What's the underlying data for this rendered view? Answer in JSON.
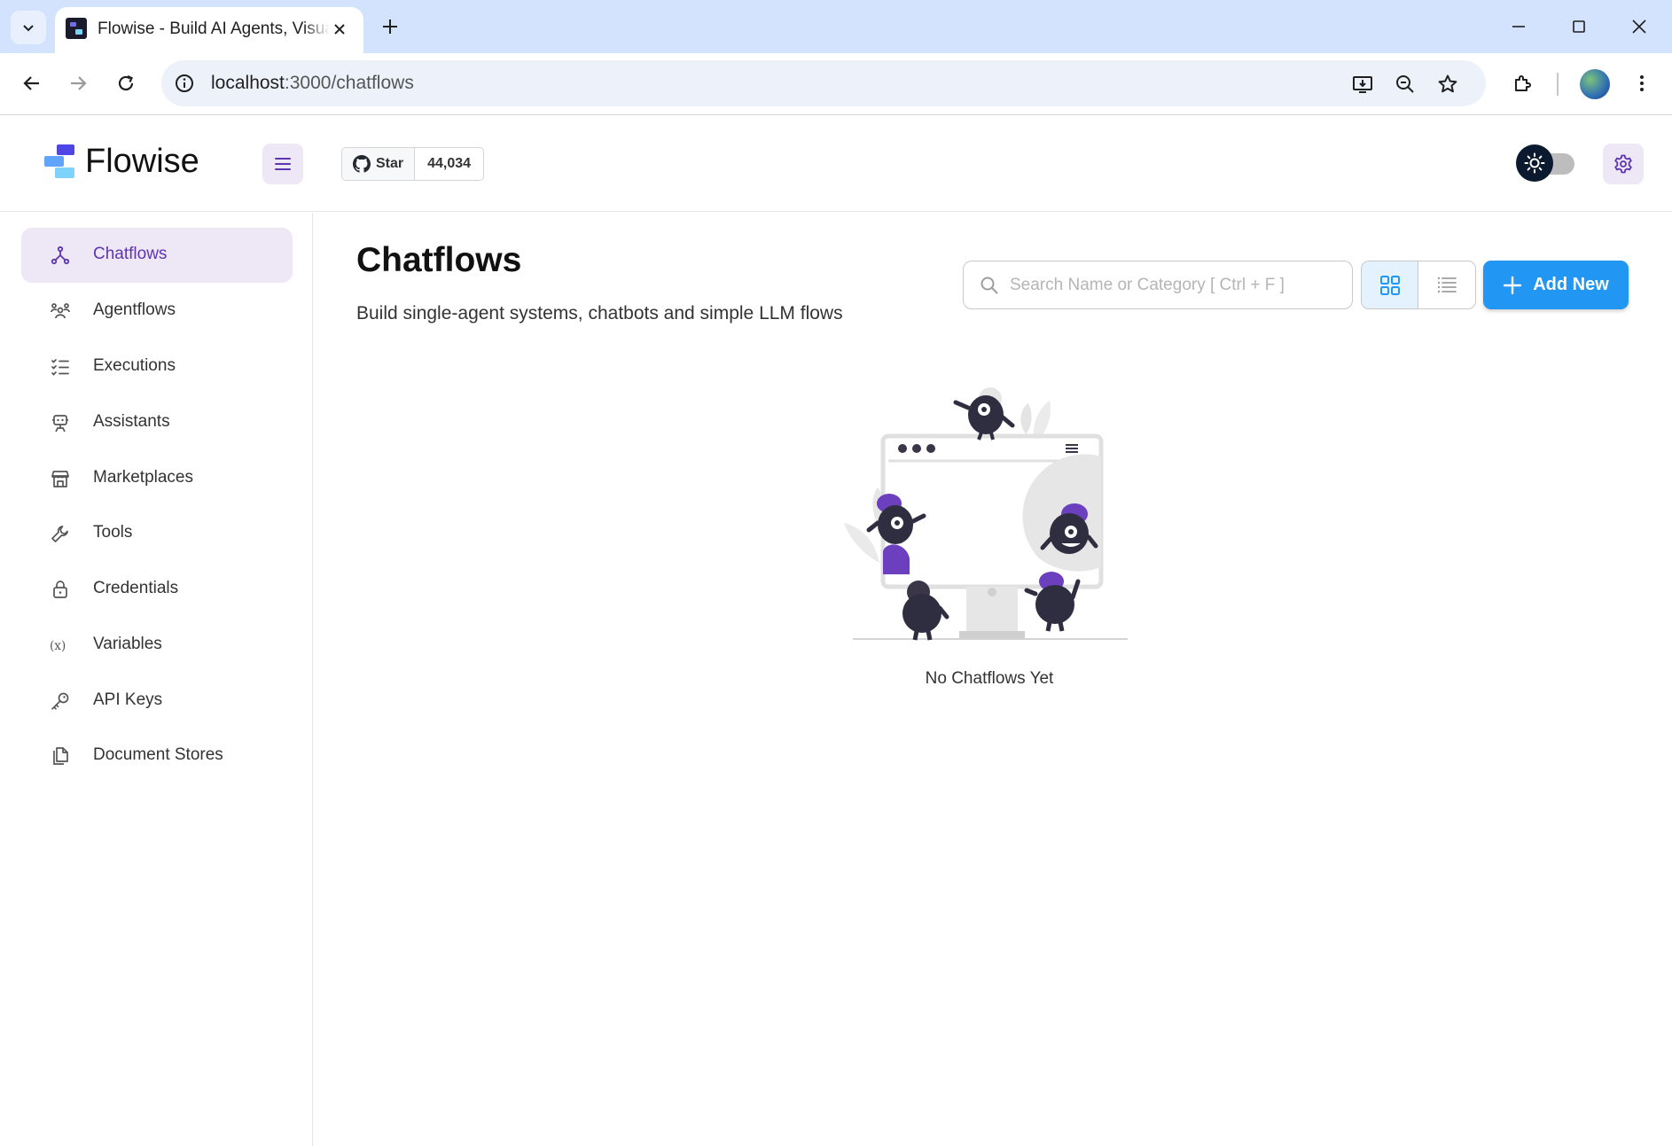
{
  "browser": {
    "tab_title": "Flowise - Build AI Agents, Visually",
    "url_host": "localhost",
    "url_path": ":3000/chatflows"
  },
  "header": {
    "brand": "Flowise",
    "github_star_label": "Star",
    "github_star_count": "44,034"
  },
  "sidebar": {
    "items": [
      {
        "label": "Chatflows",
        "icon": "hierarchy-icon",
        "active": true
      },
      {
        "label": "Agentflows",
        "icon": "users-group-icon"
      },
      {
        "label": "Executions",
        "icon": "list-check-icon"
      },
      {
        "label": "Assistants",
        "icon": "robot-icon"
      },
      {
        "label": "Marketplaces",
        "icon": "store-icon"
      },
      {
        "label": "Tools",
        "icon": "wrench-icon"
      },
      {
        "label": "Credentials",
        "icon": "lock-icon"
      },
      {
        "label": "Variables",
        "icon": "variable-icon"
      },
      {
        "label": "API Keys",
        "icon": "key-icon"
      },
      {
        "label": "Document Stores",
        "icon": "files-icon"
      }
    ]
  },
  "main": {
    "title": "Chatflows",
    "subtitle": "Build single-agent systems, chatbots and simple LLM flows",
    "search_placeholder": "Search Name or Category [ Ctrl + F ]",
    "add_button": "Add New",
    "empty_text": "No Chatflows Yet",
    "active_view": "grid"
  },
  "colors": {
    "accent_purple": "#5e35b1",
    "accent_blue": "#2196f3",
    "active_bg": "#ede7f6"
  }
}
